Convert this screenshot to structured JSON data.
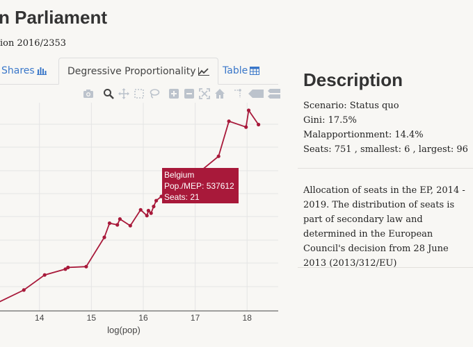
{
  "header": {
    "title": "n Parliament",
    "subtitle": "ion 2016/2353"
  },
  "tabs": [
    {
      "label": "Shares",
      "icon": "bar-chart-icon",
      "active": false
    },
    {
      "label": "Degressive Proportionality",
      "icon": "line-chart-icon",
      "active": true
    },
    {
      "label": "Table",
      "icon": "table-icon",
      "active": false
    }
  ],
  "modebar": [
    "camera-icon",
    "zoom-icon",
    "pan-icon",
    "box-select-icon",
    "lasso-icon",
    "zoom-in-icon",
    "zoom-out-icon",
    "autoscale-icon",
    "reset-axes-icon",
    "spike-lines-icon",
    "hover-closest-icon",
    "hover-compare-icon"
  ],
  "tooltip": {
    "name": "Belgium",
    "pop_line": "Pop./MEP: 537612",
    "seats_line": "Seats: 21"
  },
  "chart_data": {
    "type": "line",
    "xlabel": "log(pop)",
    "ylabel": "",
    "x_ticks": [
      "14",
      "15",
      "16",
      "17",
      "18"
    ],
    "xlim": [
      13.24,
      18.6
    ],
    "color": "#a8193a",
    "x": [
      13.2,
      13.7,
      14.1,
      14.5,
      14.55,
      14.9,
      15.25,
      15.35,
      15.5,
      15.55,
      15.75,
      15.95,
      16.07,
      16.1,
      16.15,
      16.2,
      16.25,
      16.35,
      16.45,
      16.7,
      16.8,
      17.45,
      17.65,
      17.98,
      18.03,
      18.22
    ],
    "y": [
      0.1,
      0.25,
      0.43,
      0.5,
      0.52,
      0.53,
      0.88,
      1.05,
      1.03,
      1.1,
      1.02,
      1.21,
      1.14,
      1.2,
      1.17,
      1.25,
      1.32,
      1.37,
      1.43,
      1.64,
      1.52,
      1.85,
      2.27,
      2.2,
      2.4,
      2.23
    ],
    "hover_point_index": 15
  },
  "description": {
    "title": "Description",
    "scenario": "Scenario: Status quo",
    "gini": "Gini: 17.5%",
    "malapportionment": "Malapportionment: 14.4%",
    "seats": "Seats: 751 , smallest: 6 , largest: 96",
    "text": "Allocation of seats in the EP, 2014 - 2019. The distribution of seats is part of secondary law and determined in the European Council's decision from 28 June 2013 (2013/312/EU)"
  }
}
